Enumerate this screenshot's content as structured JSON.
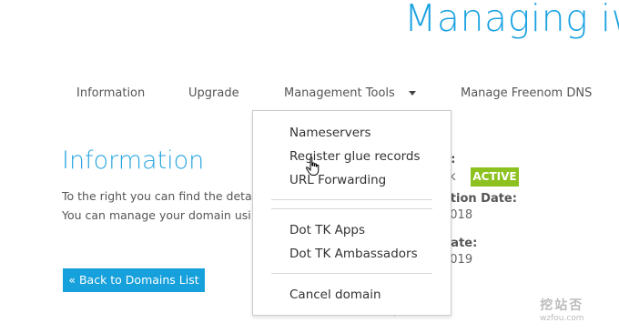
{
  "header": {
    "title": "Managing iw"
  },
  "nav": {
    "items": [
      "Information",
      "Upgrade",
      "Management Tools",
      "Manage Freenom DNS"
    ]
  },
  "main": {
    "section_title": "Information",
    "desc_line1": "To the right you can find the deta",
    "desc_line2": "You can manage your domain usi",
    "back_button": "« Back to Domains List"
  },
  "details": {
    "label1_partial": "n:",
    "status_partial": "ck",
    "status_badge": "ACTIVE",
    "label2_partial": "ation Date:",
    "value2_partial": "2018",
    "label3_partial": "date:",
    "value3_partial": "2019"
  },
  "dropdown": {
    "items": [
      "Nameservers",
      "Register glue records",
      "URL Forwarding",
      "Dot TK Apps",
      "Dot TK Ambassadors",
      "Cancel domain"
    ]
  },
  "watermark": {
    "big": "挖站否",
    "small": "wzfou.com"
  },
  "colors": {
    "accent": "#1ca3e2",
    "badge": "#8cc11f",
    "button": "#16a0dc"
  },
  "icons": {
    "dropdown": "caret-down-icon",
    "cursor": "hand-pointer-icon"
  }
}
